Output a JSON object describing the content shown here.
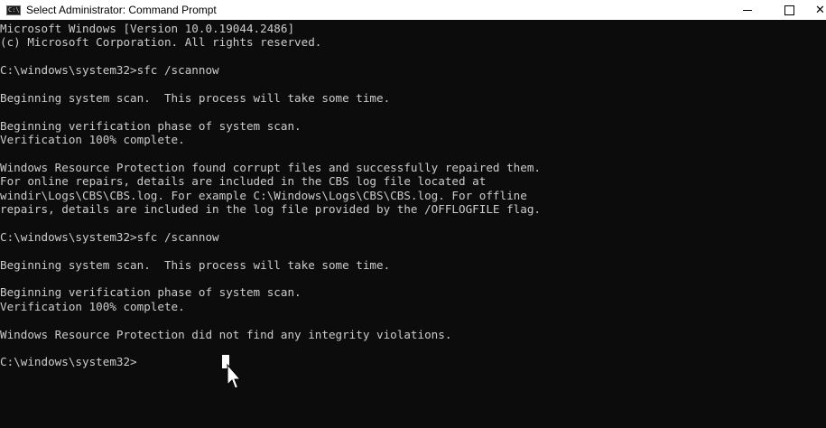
{
  "window": {
    "title": "Select Administrator: Command Prompt",
    "icon_label": "C:\\",
    "controls": {
      "minimize": "minimize-icon",
      "maximize": "maximize-icon",
      "close": "close-icon"
    }
  },
  "console": {
    "lines": [
      "Microsoft Windows [Version 10.0.19044.2486]",
      "(c) Microsoft Corporation. All rights reserved.",
      "",
      "C:\\windows\\system32>sfc /scannow",
      "",
      "Beginning system scan.  This process will take some time.",
      "",
      "Beginning verification phase of system scan.",
      "Verification 100% complete.",
      "",
      "Windows Resource Protection found corrupt files and successfully repaired them.",
      "For online repairs, details are included in the CBS log file located at",
      "windir\\Logs\\CBS\\CBS.log. For example C:\\Windows\\Logs\\CBS\\CBS.log. For offline",
      "repairs, details are included in the log file provided by the /OFFLOGFILE flag.",
      "",
      "C:\\windows\\system32>sfc /scannow",
      "",
      "Beginning system scan.  This process will take some time.",
      "",
      "Beginning verification phase of system scan.",
      "Verification 100% complete.",
      "",
      "Windows Resource Protection did not find any integrity violations.",
      "",
      "C:\\windows\\system32>"
    ]
  },
  "colors": {
    "background": "#0c0c0c",
    "text": "#cccccc",
    "titlebar": "#ffffff"
  }
}
